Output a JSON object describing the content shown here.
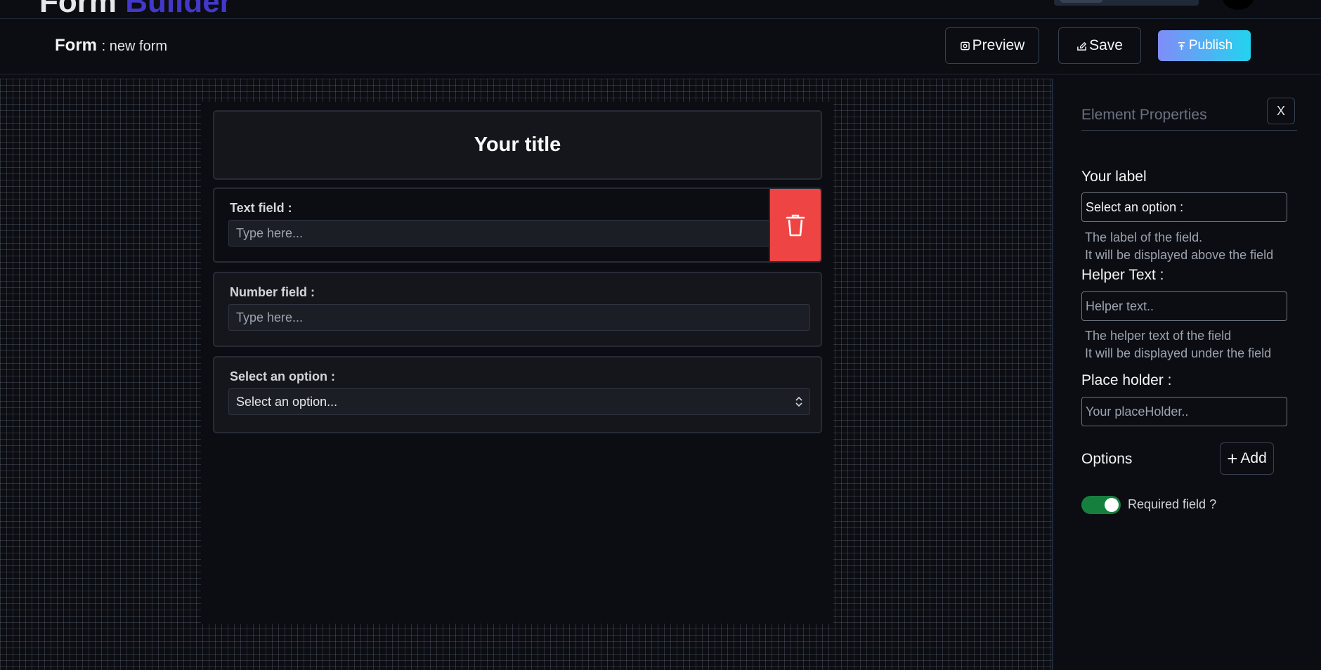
{
  "app": {
    "brand_part1": "Form",
    "brand_part2": "Builder"
  },
  "form_header": {
    "title": "Form",
    "name": ": new form",
    "preview_label": "Preview",
    "save_label": "Save",
    "publish_label": "Publish"
  },
  "form": {
    "title": "Your title",
    "fields": [
      {
        "label": "Text field :",
        "placeholder": "Type here..."
      },
      {
        "label": "Number field :",
        "placeholder": "Type here..."
      },
      {
        "label": "Select an option :",
        "placeholder": "Select an option..."
      }
    ]
  },
  "properties": {
    "title": "Element Properties",
    "close_label": "X",
    "label_heading": "Your label",
    "label_value": "Select an option :",
    "label_help_1": "The label of the field.",
    "label_help_2": "It will be displayed above the field",
    "helper_heading": "Helper Text :",
    "helper_placeholder": "Helper text..",
    "helper_help_1": "The helper text of the field",
    "helper_help_2": "It will be displayed under the field",
    "placeholder_heading": "Place holder :",
    "placeholder_placeholder": "Your placeHolder..",
    "options_heading": "Options",
    "add_label": "Add",
    "required_label": "Required field ?",
    "required_on": true
  },
  "colors": {
    "accent_gradient_start": "#818cf8",
    "accent_gradient_end": "#22d3ee",
    "delete": "#ef4444",
    "toggle_on": "#15803d",
    "brand_secondary": "#4338ca"
  }
}
